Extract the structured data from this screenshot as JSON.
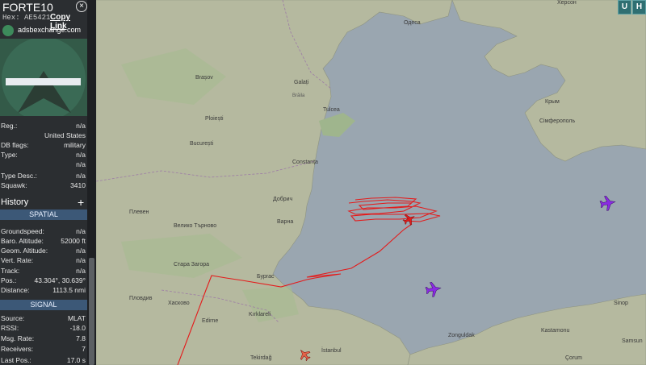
{
  "aircraft": {
    "callsign": "FORTE10",
    "hex_label": "Hex:",
    "hex": "AE5421",
    "copy_link": "Copy Link",
    "site": "adsbexchange.com"
  },
  "details": [
    {
      "label": "Reg.:",
      "value": "n/a"
    },
    {
      "label": "",
      "value": "United States"
    },
    {
      "label": "DB flags:",
      "value": "military"
    },
    {
      "label": "Type:",
      "value": "n/a"
    },
    {
      "label": "",
      "value": "n/a"
    },
    {
      "label": "Type Desc.:",
      "value": "n/a"
    },
    {
      "label": "Squawk:",
      "value": "3410"
    }
  ],
  "history_label": "History",
  "spatial": {
    "heading": "SPATIAL",
    "rows": [
      {
        "label": "Groundspeed:",
        "value": "n/a"
      },
      {
        "label": "Baro. Altitude:",
        "value": "52000 ft"
      },
      {
        "label": "Geom. Altitude:",
        "value": "n/a"
      },
      {
        "label": "Vert. Rate:",
        "value": "n/a"
      },
      {
        "label": "Track:",
        "value": "n/a"
      },
      {
        "label": "Pos.:",
        "value": "43.304°, 30.639°"
      },
      {
        "label": "Distance:",
        "value": "1113.5 nmi"
      }
    ]
  },
  "signal": {
    "heading": "SIGNAL",
    "rows": [
      {
        "label": "Source:",
        "value": "MLAT"
      },
      {
        "label": "RSSI:",
        "value": "-18.0"
      },
      {
        "label": "Msg. Rate:",
        "value": "7.8"
      },
      {
        "label": "Receivers:",
        "value": "7"
      },
      {
        "label": "Last Pos.:",
        "value": "17.0 s"
      }
    ]
  },
  "map_buttons": [
    "U",
    "H"
  ],
  "map_labels": [
    {
      "text": "Одеса",
      "cls": "place"
    },
    {
      "text": "Херсон",
      "cls": "place"
    },
    {
      "text": "Brașov",
      "cls": "place"
    },
    {
      "text": "Galați",
      "cls": "place"
    },
    {
      "text": "Brăila",
      "cls": "place"
    },
    {
      "text": "Tulcea",
      "cls": "place"
    },
    {
      "text": "Ploiești",
      "cls": "place"
    },
    {
      "text": "București",
      "cls": "place"
    },
    {
      "text": "Constanța",
      "cls": "place"
    },
    {
      "text": "Добрич",
      "cls": "place"
    },
    {
      "text": "Варна",
      "cls": "place"
    },
    {
      "text": "Плевен",
      "cls": "place"
    },
    {
      "text": "Велико Търново",
      "cls": "place"
    },
    {
      "text": "Бургас",
      "cls": "place"
    },
    {
      "text": "Стара Загора",
      "cls": "place"
    },
    {
      "text": "Пловдив",
      "cls": "place"
    },
    {
      "text": "Хасково",
      "cls": "place"
    },
    {
      "text": "Kırklareli",
      "cls": "place"
    },
    {
      "text": "Edirne",
      "cls": "place"
    },
    {
      "text": "Tekirdağ",
      "cls": "place"
    },
    {
      "text": "İstanbul",
      "cls": "place"
    },
    {
      "text": "Сімферополь",
      "cls": "place"
    },
    {
      "text": "Крым",
      "cls": "place"
    },
    {
      "text": "Kastamonu",
      "cls": "place"
    },
    {
      "text": "Zonguldak",
      "cls": "place"
    },
    {
      "text": "Sinop",
      "cls": "place"
    },
    {
      "text": "Samsun",
      "cls": "place"
    },
    {
      "text": "Çorum",
      "cls": "place"
    }
  ],
  "colors": {
    "panel_bg": "#2b2e31",
    "section_header": "#3c5877",
    "track": "#e41b1b",
    "aircraft_purple": "#8a2be2",
    "sea": "#9aa6b0",
    "land": "#b7bca0"
  }
}
